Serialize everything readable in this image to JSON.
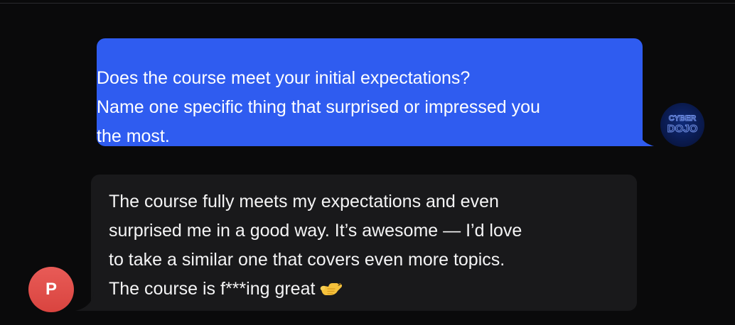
{
  "bot_message": {
    "lines": [
      "Does the course meet your initial expectations?",
      "Name one specific thing that surprised or impressed you",
      "the most."
    ],
    "avatar": {
      "logo_text_top": "CYBER",
      "logo_text_bottom": "DOJO",
      "icon": "cyber-dojo-logo-icon"
    },
    "bubble_color": "#2f5cf0"
  },
  "user_message": {
    "lines": [
      "The course fully meets my expectations and even",
      "surprised me in a good way. It’s awesome — I’d love",
      "to take a similar one that covers even more topics.",
      "The course is f***ing great"
    ],
    "emoji": "call-me-hand-emoji",
    "avatar_initial": "P",
    "avatar_color": "#e0504b",
    "bubble_color": "#19191b"
  }
}
